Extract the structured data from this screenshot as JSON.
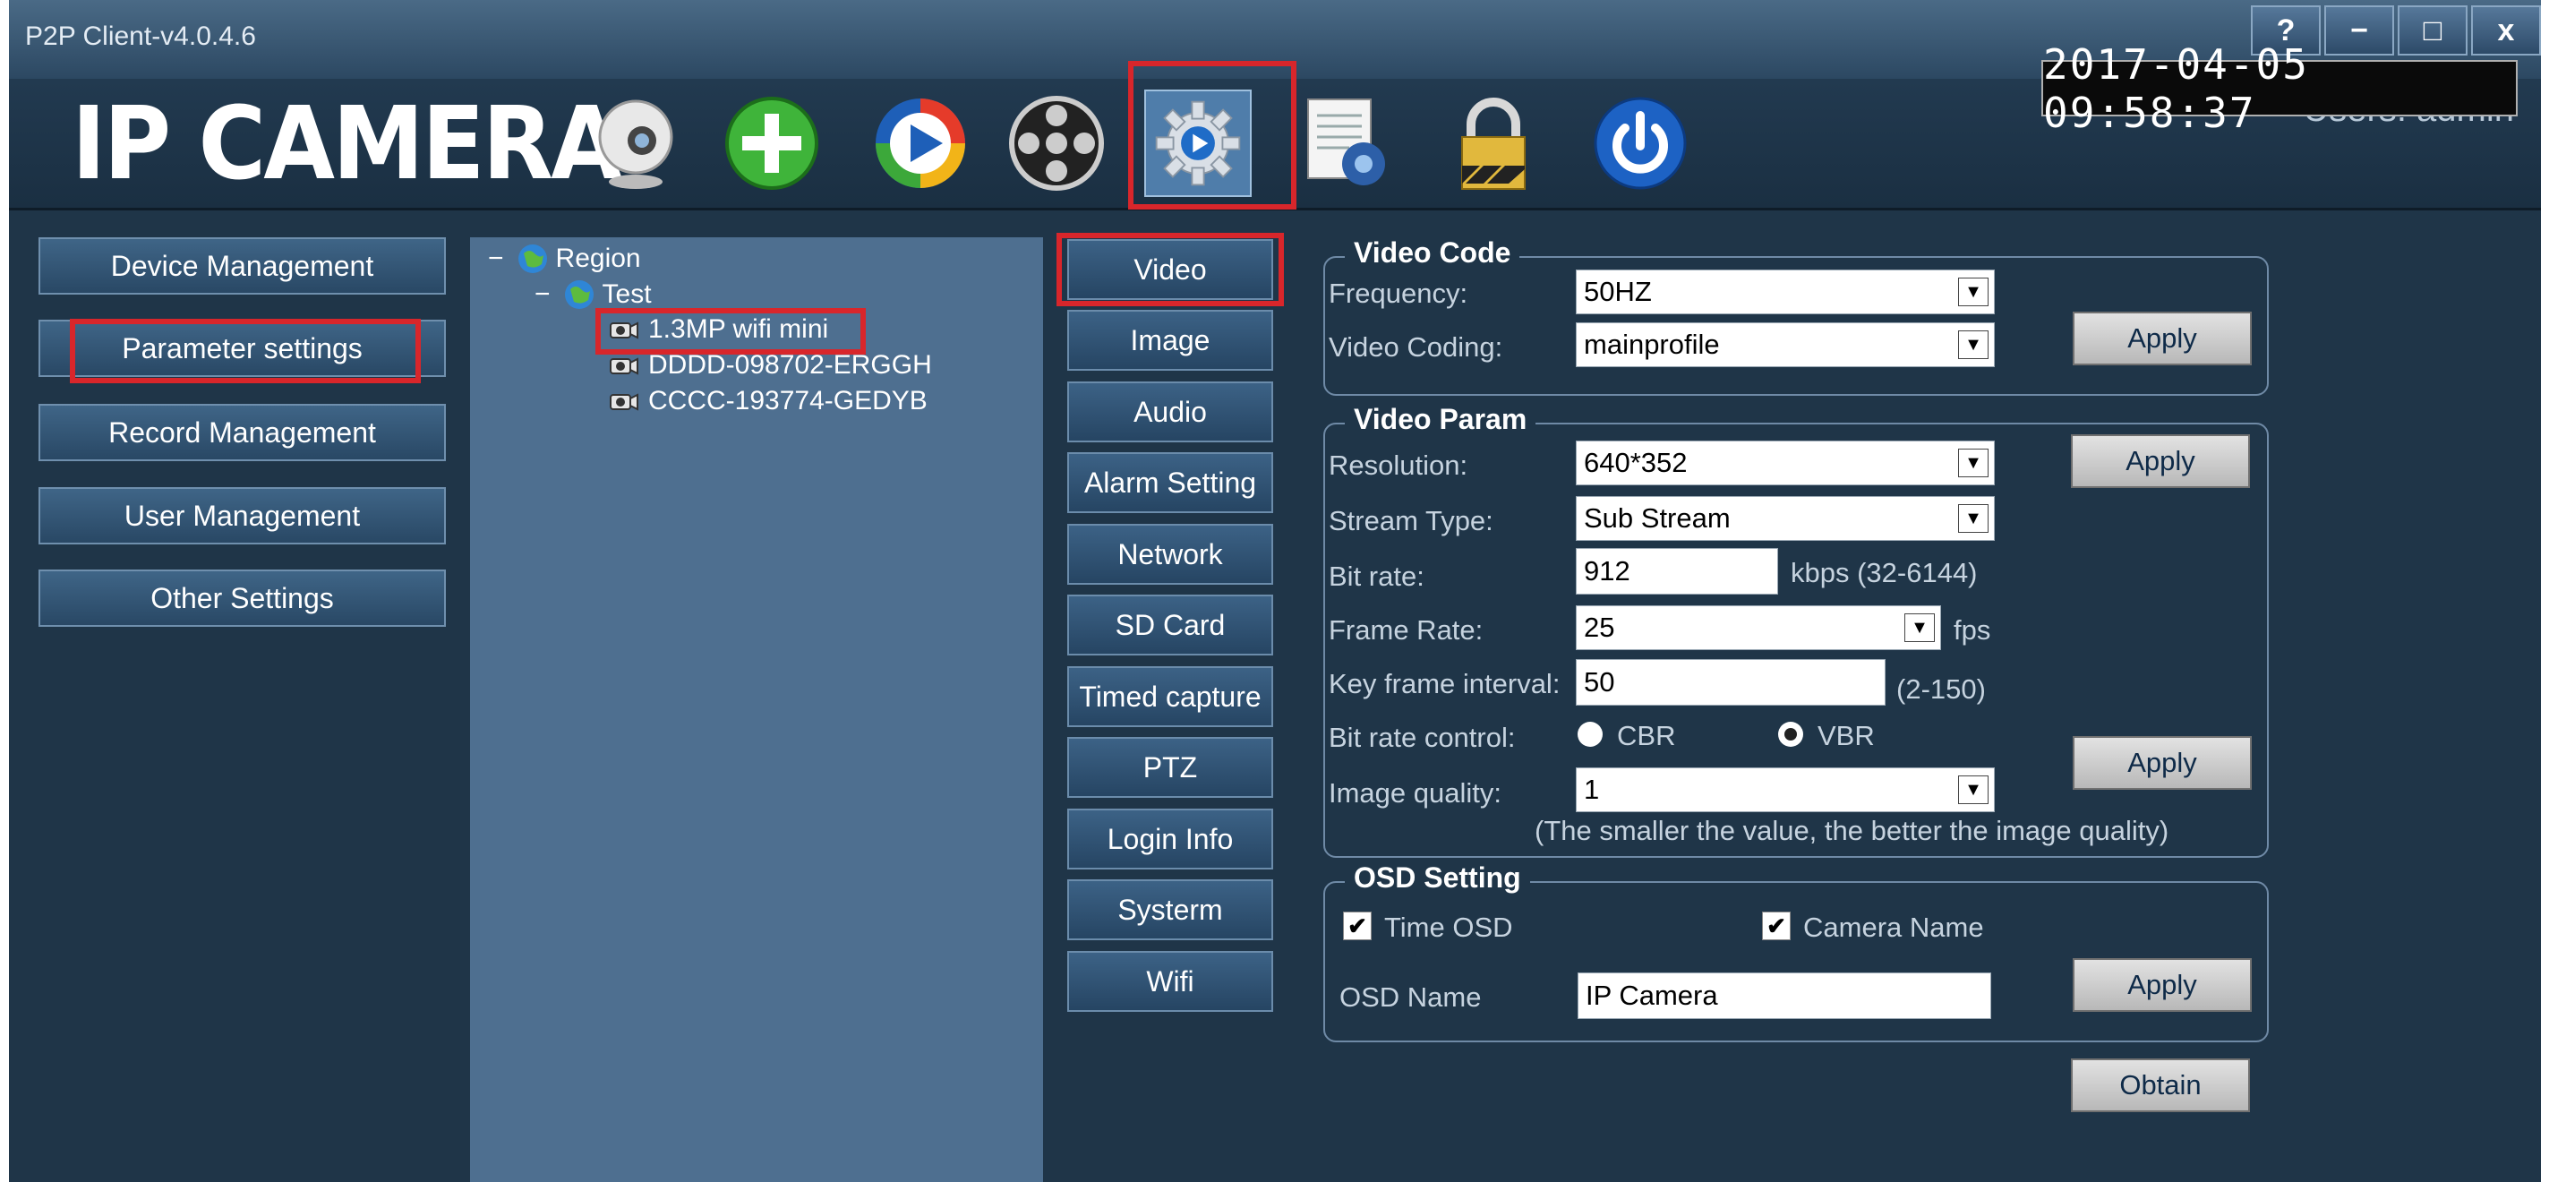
{
  "window": {
    "title": "P2P Client-v4.0.4.6",
    "help": "?",
    "minimize": "−",
    "maximize": "□",
    "close": "x"
  },
  "header": {
    "logo": "IP CAMERA",
    "users_label": "Users: admin",
    "datetime": "2017-04-05 09:58:37",
    "toolbar_icons": [
      "webcam-icon",
      "add-icon",
      "playback-icon",
      "video-reel-icon",
      "settings-gear-icon",
      "log-document-icon",
      "lock-icon",
      "power-icon"
    ]
  },
  "sidebar": {
    "items": [
      {
        "label": "Device Management"
      },
      {
        "label": "Parameter settings"
      },
      {
        "label": "Record Management"
      },
      {
        "label": "User Management"
      },
      {
        "label": "Other Settings"
      }
    ]
  },
  "tree": {
    "root": "Region",
    "group": "Test",
    "devices": [
      "1.3MP wifi mini",
      "DDDD-098702-ERGGH",
      "CCCC-193774-GEDYB"
    ],
    "collapse_symbol": "−"
  },
  "tabs": [
    "Video",
    "Image",
    "Audio",
    "Alarm Setting",
    "Network",
    "SD Card",
    "Timed capture",
    "PTZ",
    "Login Info",
    "Systerm",
    "Wifi"
  ],
  "video_code": {
    "title": "Video Code",
    "frequency_label": "Frequency:",
    "frequency_value": "50HZ",
    "coding_label": "Video Coding:",
    "coding_value": "mainprofile",
    "apply": "Apply"
  },
  "video_param": {
    "title": "Video Param",
    "resolution_label": "Resolution:",
    "resolution_value": "640*352",
    "stream_label": "Stream Type:",
    "stream_value": "Sub Stream",
    "bitrate_label": "Bit rate:",
    "bitrate_value": "912",
    "bitrate_hint": "kbps (32-6144)",
    "framerate_label": "Frame Rate:",
    "framerate_value": "25",
    "framerate_unit": "fps",
    "keyframe_label": "Key frame interval:",
    "keyframe_value": "50",
    "keyframe_hint": "(2-150)",
    "brc_label": "Bit rate control:",
    "cbr_label": "CBR",
    "vbr_label": "VBR",
    "brc_selected": "VBR",
    "quality_label": "Image quality:",
    "quality_value": "1",
    "quality_hint": "(The smaller the value, the better the image quality)",
    "apply_top": "Apply",
    "apply_bottom": "Apply"
  },
  "osd": {
    "title": "OSD Setting",
    "time_osd_label": "Time OSD",
    "time_osd_checked": true,
    "camera_name_label": "Camera Name",
    "camera_name_checked": true,
    "name_label": "OSD Name",
    "name_value": "IP Camera",
    "apply": "Apply"
  },
  "obtain": "Obtain",
  "colors": {
    "highlight": "#d8262b",
    "panel": "#1f3548",
    "tree_bg": "#4e6f90"
  }
}
